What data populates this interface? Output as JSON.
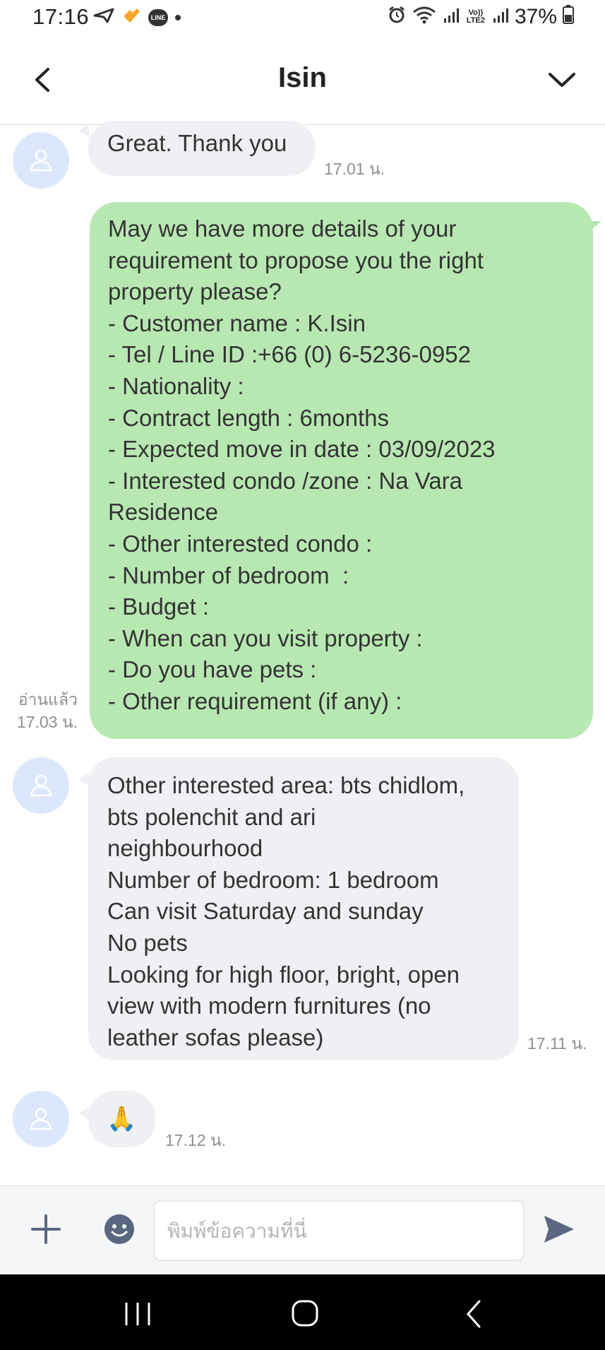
{
  "status_bar": {
    "time": "17:16",
    "battery": "37%",
    "volte": "Vo)) LTE2"
  },
  "header": {
    "title": "Isin",
    "back_icon": "chevron-left-icon",
    "menu_icon": "chevron-down-icon"
  },
  "messages": [
    {
      "direction": "incoming",
      "lines": [
        "Great. Thank you"
      ],
      "time": "17.01 น."
    },
    {
      "direction": "outgoing",
      "lines": [
        "May we have more details of your",
        "requirement to propose you the right",
        "property please?",
        "- Customer name : K.Isin",
        "- Tel / Line ID :+66 (0) 6-5236-0952",
        "- Nationality :",
        "- Contract length : 6months",
        "- Expected move in date : 03/09/2023",
        "- Interested condo /zone : Na Vara",
        "Residence",
        "- Other interested condo :",
        "- Number of bedroom  :",
        "- Budget :",
        "- When can you visit property :",
        "- Do you have pets :",
        "- Other requirement (if any) :"
      ],
      "read": "อ่านแล้ว",
      "time": "17.03 น."
    },
    {
      "direction": "incoming",
      "lines": [
        "Other interested area: bts chidlom,",
        "bts polenchit and ari",
        "neighbourhood",
        "Number of bedroom: 1 bedroom",
        "Can visit Saturday and sunday",
        "No pets",
        "Looking for high floor, bright, open",
        "view with modern furnitures (no",
        "leather sofas please)"
      ],
      "time": "17.11 น."
    },
    {
      "direction": "incoming",
      "lines": [
        "🙏"
      ],
      "time": "17.12 น."
    }
  ],
  "input_bar": {
    "placeholder": "พิมพ์ข้อความที่นี่",
    "value": ""
  },
  "colors": {
    "outgoing_bubble": "#b8e8b2",
    "incoming_bubble": "#eff0f3",
    "avatar_bg": "#dde7fb",
    "accent": "#5a6780"
  }
}
